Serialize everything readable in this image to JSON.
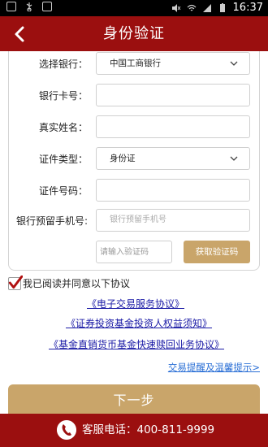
{
  "status_bar": {
    "time": "16:37"
  },
  "header": {
    "title": "身份验证"
  },
  "form": {
    "bank": {
      "label": "选择银行：",
      "value": "中国工商银行"
    },
    "card_no": {
      "label": "银行卡号：",
      "value": ""
    },
    "name": {
      "label": "真实姓名：",
      "value": ""
    },
    "id_type": {
      "label": "证件类型：",
      "value": "身份证"
    },
    "id_no": {
      "label": "证件号码：",
      "value": ""
    },
    "phone": {
      "label": "银行预留手机号:",
      "placeholder": "银行预留手机号"
    },
    "verify_code": {
      "placeholder": "请输入验证码"
    },
    "get_code_button": "获取验证码"
  },
  "agreement": {
    "checked": true,
    "text": "我已阅读并同意以下协议",
    "links": [
      "《电子交易服务协议》",
      "《证券投资基金投资人权益须知》",
      "《基金直销货币基金快速赎回业务协议》"
    ],
    "tips_link": "交易提醒及温馨提示>"
  },
  "next_button": "下一步",
  "footer": {
    "hotline": "客服电话：400-811-9999"
  },
  "colors": {
    "brand_red": "#9b0f0f",
    "gold": "#c9a56a",
    "link_blue": "#2a6fd6"
  }
}
